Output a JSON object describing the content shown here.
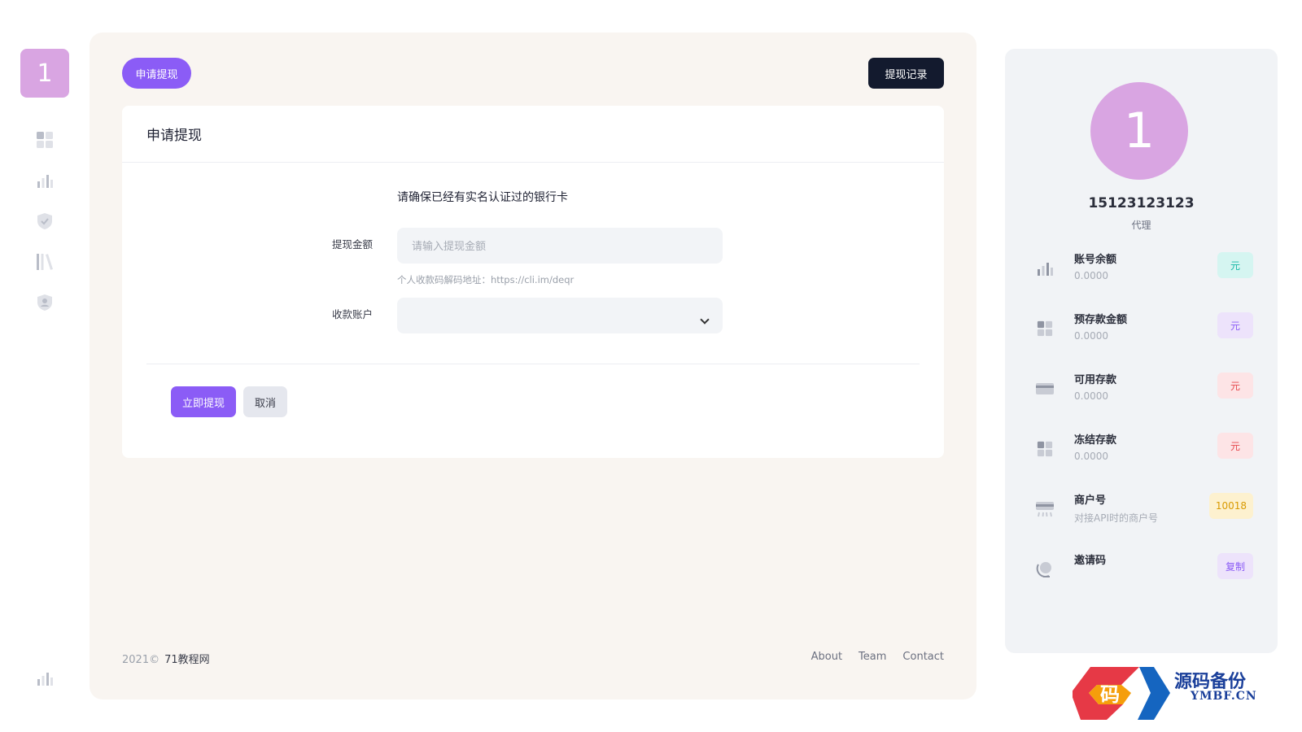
{
  "rail": {
    "logo_text": "1",
    "icons": [
      "grid-icon",
      "bar-chart-icon",
      "shield-check-icon",
      "library-icon",
      "user-shield-icon",
      "bar-chart-icon"
    ]
  },
  "header": {
    "tab_label": "申请提现",
    "records_button": "提现记录"
  },
  "form": {
    "card_title": "申请提现",
    "notice": "请确保已经有实名认证过的银行卡",
    "amount_label": "提现金额",
    "amount_placeholder": "请输入提现金额",
    "amount_value": "",
    "qr_hint": "个人收款码解码地址：https://cli.im/deqr",
    "account_label": "收款账户",
    "account_value": "",
    "submit_label": "立即提现",
    "cancel_label": "取消"
  },
  "footer": {
    "copyright": "2021©",
    "brand": "71教程网",
    "links": [
      "About",
      "Team",
      "Contact"
    ]
  },
  "profile": {
    "avatar_text": "1",
    "username": "15123123123",
    "role": "代理",
    "stats": [
      {
        "icon": "bar-chart-icon",
        "label": "账号余额",
        "value": "0.0000",
        "badge": "元",
        "badge_bg": "#d5f5f1",
        "badge_color": "#15b8a6"
      },
      {
        "icon": "grid-icon",
        "label": "预存款金额",
        "value": "0.0000",
        "badge": "元",
        "badge_bg": "#ede3fb",
        "badge_color": "#8b5cf6"
      },
      {
        "icon": "credit-card-icon",
        "label": "可用存款",
        "value": "0.0000",
        "badge": "元",
        "badge_bg": "#fde4e6",
        "badge_color": "#e5484d"
      },
      {
        "icon": "grid-icon",
        "label": "冻结存款",
        "value": "0.0000",
        "badge": "元",
        "badge_bg": "#fde4e6",
        "badge_color": "#e5484d"
      },
      {
        "icon": "terminal-icon",
        "label": "商户号",
        "value": "对接API时的商户号",
        "badge": "10018",
        "badge_bg": "#fdf1cf",
        "badge_color": "#d99a00"
      },
      {
        "icon": "globe-icon",
        "label": "邀请码",
        "value": "",
        "badge": "复制",
        "badge_bg": "#ede3fb",
        "badge_color": "#8b5cf6"
      }
    ]
  },
  "watermark": {
    "logo_glyph": "码",
    "title": "源码备份",
    "subtitle": "YMBF.CN"
  },
  "colors": {
    "accent": "#8b5cf6",
    "dark": "#131a2e",
    "avatar": "#d9a5e2",
    "main_bg": "#f9f5f1",
    "side_bg": "#f1f3f6"
  }
}
